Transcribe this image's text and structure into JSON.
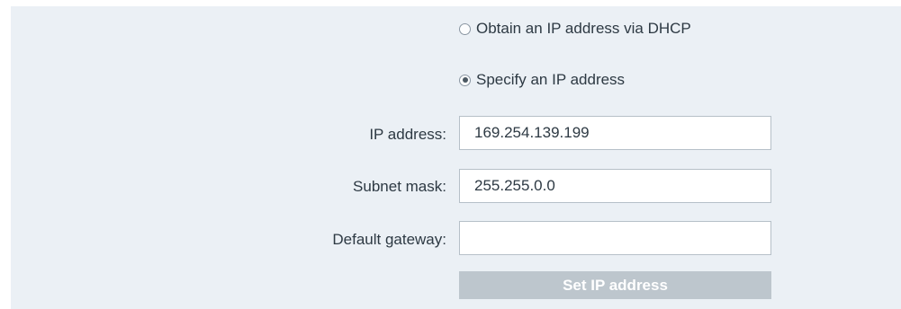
{
  "ip_mode": {
    "options": [
      {
        "label": "Obtain an IP address via DHCP",
        "selected": false
      },
      {
        "label": "Specify an IP address",
        "selected": true
      }
    ]
  },
  "fields": {
    "ip_address": {
      "label": "IP address:",
      "value": "169.254.139.199"
    },
    "subnet_mask": {
      "label": "Subnet mask:",
      "value": "255.255.0.0"
    },
    "default_gateway": {
      "label": "Default gateway:",
      "value": ""
    }
  },
  "actions": {
    "set_ip_label": "Set IP address",
    "set_ip_enabled": false
  },
  "colors": {
    "panel_background": "#ebf0f5",
    "button_disabled": "#bdc6cd",
    "text": "#2d3943"
  }
}
